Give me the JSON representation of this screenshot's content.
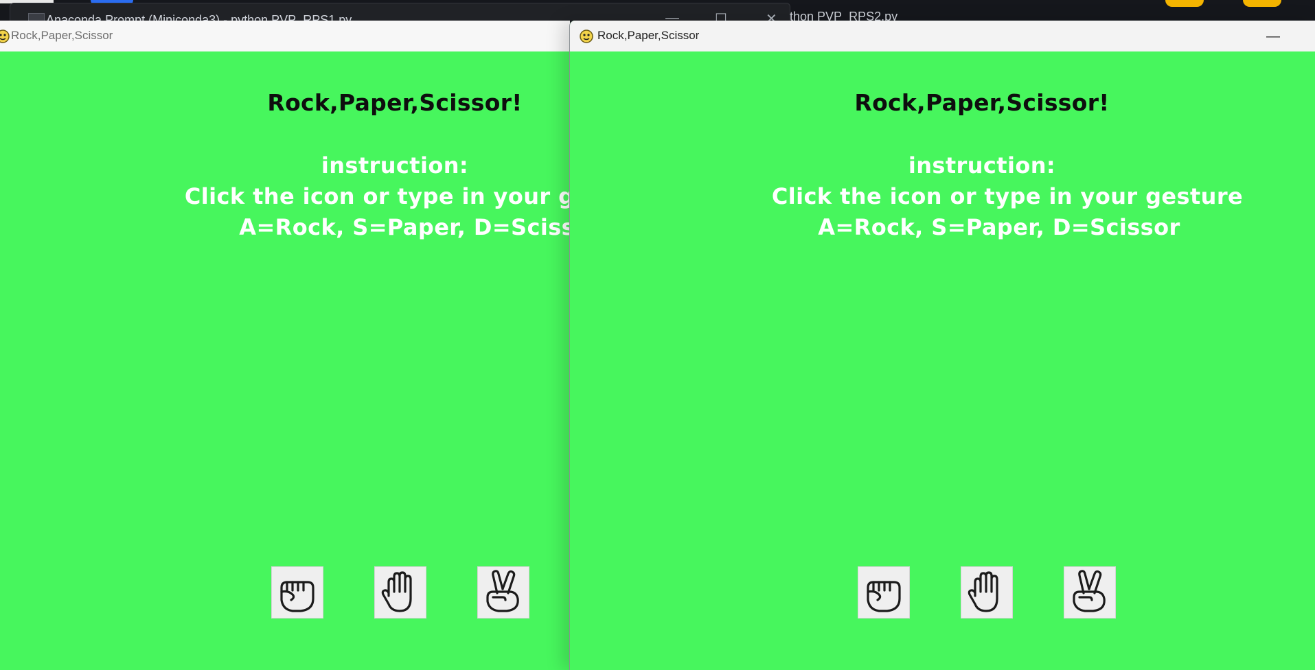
{
  "background": {
    "console_title": "Anaconda Prompt (Miniconda3) - python  PVP_RPS1.py",
    "second_title": "thon  PVP_RPS2.py"
  },
  "windows": [
    {
      "title": "Rock,Paper,Scissor",
      "game_title": "Rock,Paper,Scissor!",
      "instruction_label": "instruction:",
      "instruction_line1": "Click the icon or type in your gesture",
      "instruction_line2": "A=Rock, S=Paper, D=Scissor",
      "gestures": [
        {
          "label": "rock-icon"
        },
        {
          "label": "paper-icon"
        },
        {
          "label": "scissor-icon"
        }
      ]
    },
    {
      "title": "Rock,Paper,Scissor",
      "game_title": "Rock,Paper,Scissor!",
      "instruction_label": "instruction:",
      "instruction_line1": "Click the icon or type in your gesture",
      "instruction_line2": "A=Rock, S=Paper, D=Scissor",
      "minimize_label": "—",
      "gestures": [
        {
          "label": "rock-icon"
        },
        {
          "label": "paper-icon"
        },
        {
          "label": "scissor-icon"
        }
      ]
    }
  ],
  "colors": {
    "game_background": "#47f65d",
    "title_text": "#0e0e0e",
    "instruction_text": "#ffffff"
  }
}
